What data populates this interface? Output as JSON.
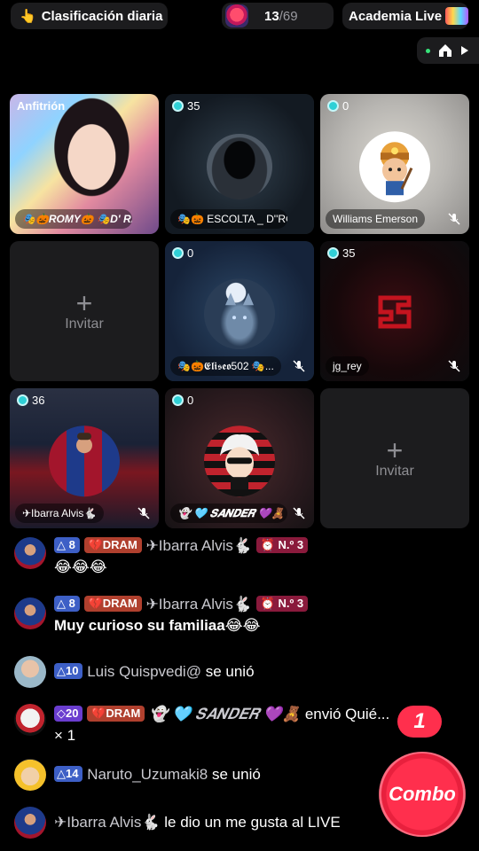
{
  "topbar": {
    "rank_label": "Clasificación diaria",
    "viewers_current": "13",
    "viewers_total": "/69",
    "academy_label": "Academia Live"
  },
  "tiles": [
    {
      "tag": "Anfitrión",
      "name": "🎭🎃ROMY🎃 🎭D' RAFA",
      "muted": false
    },
    {
      "tag": "35",
      "name": "🎭🎃 ESCOLTA _ D''RO...",
      "muted": false
    },
    {
      "tag": "0",
      "name": "Williams Emerson",
      "muted": true
    },
    {
      "invite": "Invitar"
    },
    {
      "tag": "0",
      "name": "🎭🎃𝕰𝖑𝖎𝖘𝖊𝖔502 🎭...",
      "muted": true
    },
    {
      "tag": "35",
      "name": "jg_rey",
      "muted": true
    },
    {
      "tag": "36",
      "name": "✈Ibarra Alvis🐇",
      "muted": true
    },
    {
      "tag": "0",
      "name": "👻 🩵 𝑺𝑨𝑵𝑫𝑬𝑹 💜🧸",
      "muted": true
    },
    {
      "invite": "Invitar"
    }
  ],
  "chat": [
    {
      "level": "8",
      "fan": "💔DRAM",
      "user": "✈Ibarra Alvis🐇",
      "rank": "⏰ N.º 3",
      "text": "😂😂😂"
    },
    {
      "level": "8",
      "fan": "💔DRAM",
      "user": "✈Ibarra Alvis🐇",
      "rank": "⏰ N.º 3",
      "text": "Muy curioso su familiaa😂😂"
    },
    {
      "level": "10",
      "user": "Luis Quispvedi@",
      "action": "se unió"
    },
    {
      "level": "20",
      "fan": "💔DRAM",
      "user": "👻 🩵 𝑺𝑨𝑵𝑫𝑬𝑹 💜🧸",
      "action": "envió Quié...",
      "suffix": "× 1"
    },
    {
      "level": "14",
      "user": "Naruto_Uzumaki8",
      "action": "se unió"
    },
    {
      "user": "✈Ibarra Alvis🐇",
      "action": "le dio un me gusta al LIVE"
    }
  ],
  "combo": {
    "label": "Combo",
    "count": "1"
  },
  "colors": {
    "accent": "#ff2f4d",
    "diamond": "#2fd0d6",
    "level_badge": "#3d5fc6",
    "fan_badge": "#b0402e"
  }
}
